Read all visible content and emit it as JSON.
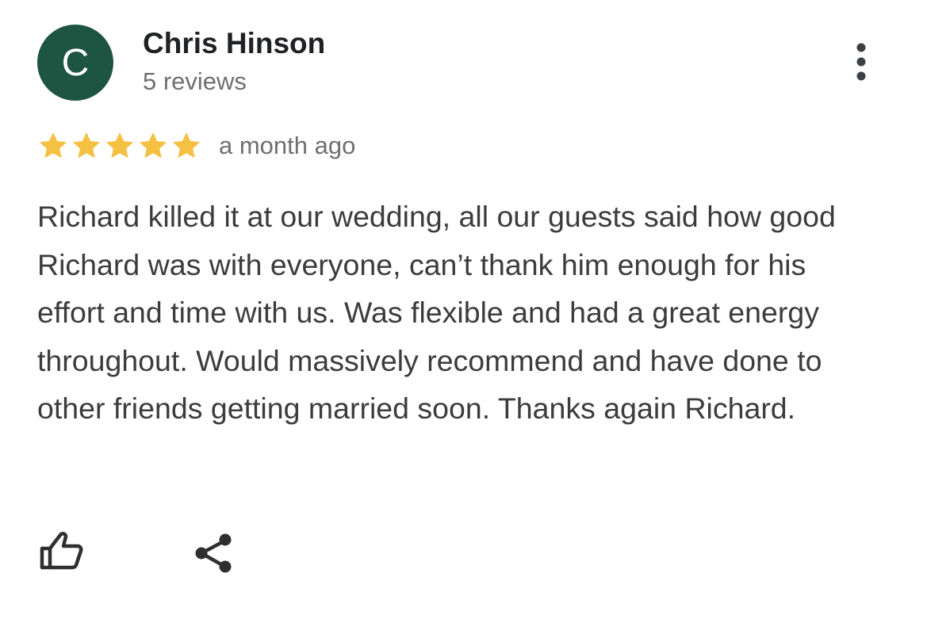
{
  "reviewer": {
    "avatar_letter": "C",
    "avatar_color": "#1d5542",
    "name": "Chris Hinson",
    "review_count": "5 reviews"
  },
  "review": {
    "rating": 5,
    "max_rating": 5,
    "star_color": "#f4c142",
    "date": "a month ago",
    "text": "Richard killed it at our wedding, all our guests said how good Richard was with everyone, can’t thank him enough for his effort and time with us. Was flexible and had a great energy throughout. Would massively recommend and have done to other friends getting married soon. Thanks again Richard."
  },
  "icons": {
    "menu": "more-vertical-icon",
    "like": "thumbs-up-icon",
    "share": "share-icon"
  }
}
